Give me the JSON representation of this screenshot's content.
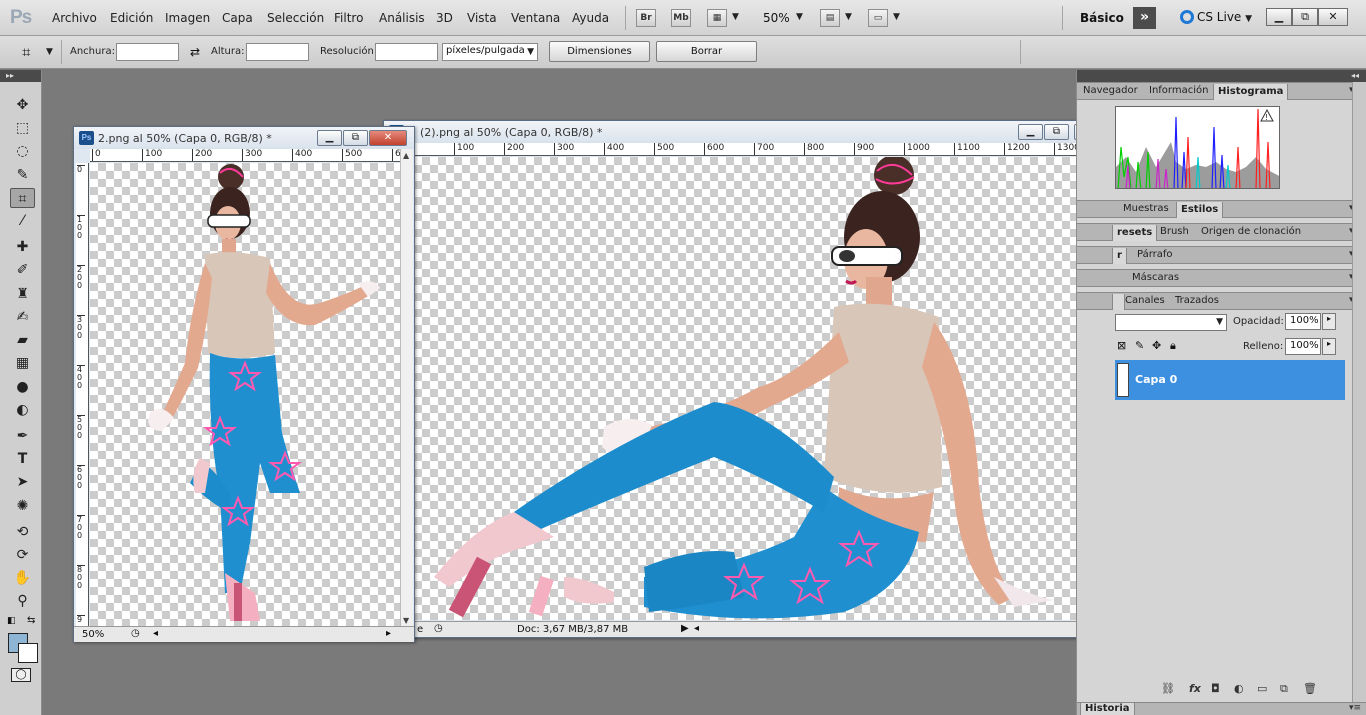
{
  "app": {
    "logo": "Ps"
  },
  "menu": {
    "items": [
      "Archivo",
      "Edición",
      "Imagen",
      "Capa",
      "Selección",
      "Filtro",
      "Análisis",
      "3D",
      "Vista",
      "Ventana",
      "Ayuda"
    ],
    "bridge_label": "Br",
    "minibridge_label": "Mb",
    "zoom": "50%",
    "workspace": "Básico",
    "cslive": "CS Live"
  },
  "options": {
    "width_label": "Anchura:",
    "width_value": "",
    "height_label": "Altura:",
    "height_value": "",
    "resolution_label": "Resolución:",
    "resolution_value": "",
    "units": "píxeles/pulgada",
    "dimensions_button": "Dimensiones",
    "clear_button": "Borrar"
  },
  "tools": [
    "move-tool",
    "marquee-tool",
    "lasso-tool",
    "quick-selection-tool",
    "crop-tool",
    "eyedropper-tool",
    "spot-healing-tool",
    "brush-tool",
    "clone-stamp-tool",
    "history-brush-tool",
    "eraser-tool",
    "gradient-tool",
    "blur-tool",
    "dodge-tool",
    "pen-tool",
    "type-tool",
    "path-selection-tool",
    "shape-tool",
    "3d-rotate-tool",
    "3d-orbit-tool",
    "hand-tool",
    "zoom-tool"
  ],
  "colors": {
    "foreground": "#8fb5d4",
    "background": "#ffffff",
    "selection": "#3d8fe0"
  },
  "doc1": {
    "ps_icon": "Ps",
    "title": "2.png al 50% (Capa 0, RGB/8) *",
    "ruler_h": [
      "0",
      "100",
      "200",
      "300",
      "400",
      "500",
      "6"
    ],
    "ruler_v": [
      "0",
      "1\n0\n0",
      "2\n0\n0",
      "3\n0\n0",
      "4\n0\n0",
      "5\n0\n0",
      "6\n0\n0",
      "7\n0\n0",
      "8\n0\n0",
      "9"
    ],
    "zoom": "50%"
  },
  "doc2": {
    "ps_icon": "Ps",
    "title": "(2).png al 50% (Capa 0, RGB/8) *",
    "ruler_h": [
      "100",
      "200",
      "300",
      "400",
      "500",
      "600",
      "700",
      "800",
      "900",
      "1000",
      "1100",
      "1200",
      "1300"
    ],
    "status_zoom": "e",
    "doc_info": "Doc: 3,67 MB/3,87 MB"
  },
  "panels": {
    "group1_tabs": [
      "Navegador",
      "Información",
      "Histograma"
    ],
    "group2_tabs": [
      "Muestras",
      "Estilos"
    ],
    "group3_tabs": [
      "resets",
      "Brush",
      "Origen de clonación"
    ],
    "group4_tabs": [
      "r",
      "Párrafo"
    ],
    "group5_tabs": [
      "Máscaras"
    ],
    "group6_tabs": [
      "Canales",
      "Trazados"
    ],
    "opacity_label": "Opacidad:",
    "opacity_value": "100%",
    "fill_label": "Relleno:",
    "fill_value": "100%",
    "layer_name": "Capa 0",
    "history_tab": "Historia"
  }
}
